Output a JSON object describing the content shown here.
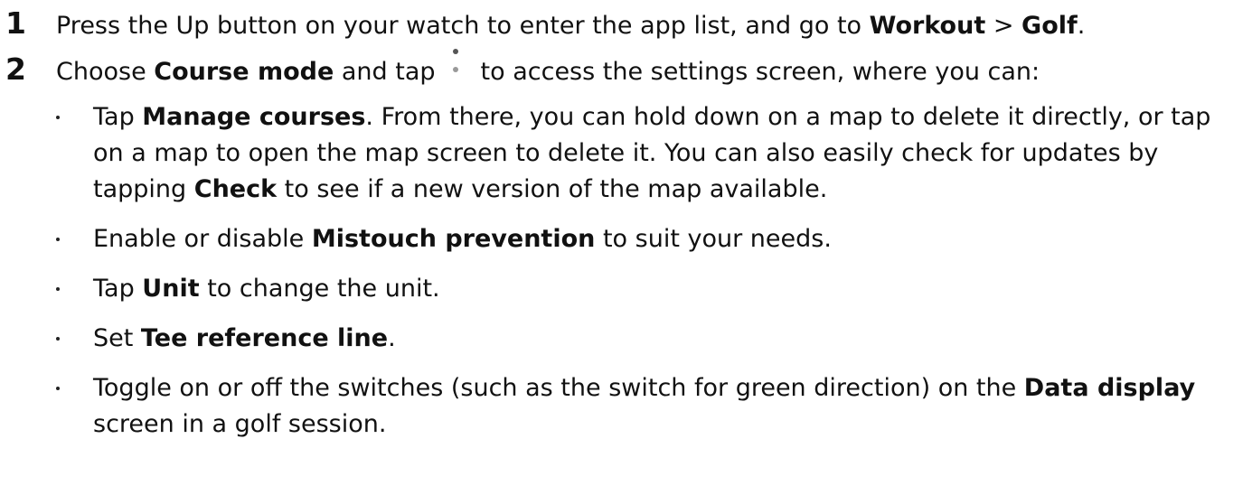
{
  "steps": [
    {
      "number": "1",
      "t1": "Press the Up button on your watch to enter the app list, and go to ",
      "b1": "Workout",
      "t2": " > ",
      "b2": "Golf",
      "t3": "."
    },
    {
      "number": "2",
      "t1": "Choose ",
      "b1": "Course mode",
      "t2": " and tap",
      "icon": "more-vertical-icon",
      "t3": "to access the settings screen, where you can:"
    }
  ],
  "bullets": [
    {
      "t1": "Tap ",
      "b1": "Manage courses",
      "t2": ". From there, you can hold down on a map to delete it directly, or tap on a map to open the map screen to delete it. You can also easily check for updates by tapping ",
      "b2": "Check",
      "t3": " to see if a new version of the map available."
    },
    {
      "t1": "Enable or disable ",
      "b1": "Mistouch prevention",
      "t2": " to suit your needs."
    },
    {
      "t1": "Tap ",
      "b1": "Unit",
      "t2": " to change the unit."
    },
    {
      "t1": "Set ",
      "b1": "Tee reference line",
      "t2": "."
    },
    {
      "t1": "Toggle on or off the switches (such as the switch for green direction) on the ",
      "b1": "Data display",
      "t2": " screen in a golf session."
    }
  ]
}
